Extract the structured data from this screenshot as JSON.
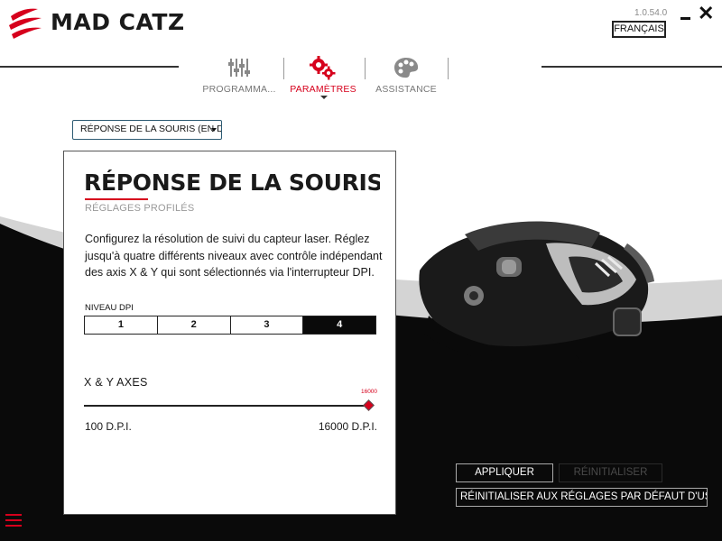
{
  "header": {
    "brand": "MAD CATZ",
    "version": "1.0.54.0",
    "language_button": "FRANÇAIS",
    "close_glyph": "✕"
  },
  "tabs": [
    {
      "label": "PROGRAMMA...",
      "icon": "sliders-icon",
      "active": false
    },
    {
      "label": "PARAMÈTRES",
      "icon": "gears-icon",
      "active": true
    },
    {
      "label": "ASSISTANCE",
      "icon": "palette-icon",
      "active": false
    }
  ],
  "dropdown": {
    "selected": "RÉPONSE DE LA SOURIS (EN D"
  },
  "panel": {
    "title": "RÉPONSE DE LA SOURIS (EN DPI)",
    "subtitle": "RÉGLAGES PROFILÉS",
    "description": "Configurez la résolution de suivi du capteur laser. Réglez jusqu'à quatre différents niveaux avec contrôle indépendant des axis X & Y qui sont sélectionnés via l'interrupteur DPI.",
    "dpi_level_label": "NIVEAU DPI",
    "dpi_levels": [
      "1",
      "2",
      "3",
      "4"
    ],
    "selected_level": 4,
    "axes_label": "X & Y AXES",
    "slider": {
      "min": 100,
      "max": 16000,
      "value": 16000,
      "value_text": "16000"
    },
    "min_label": "100 D.P.I.",
    "max_label": "16000 D.P.I."
  },
  "buttons": {
    "apply": "APPLIQUER",
    "reset": "RÉINITIALISER",
    "defaults": "RÉINITIALISER AUX RÉGLAGES PAR DÉFAUT D'US"
  },
  "colors": {
    "accent": "#d6001c",
    "dark": "#0a0a0a",
    "panel_border": "#555555",
    "dropdown_border": "#2d5b73"
  }
}
